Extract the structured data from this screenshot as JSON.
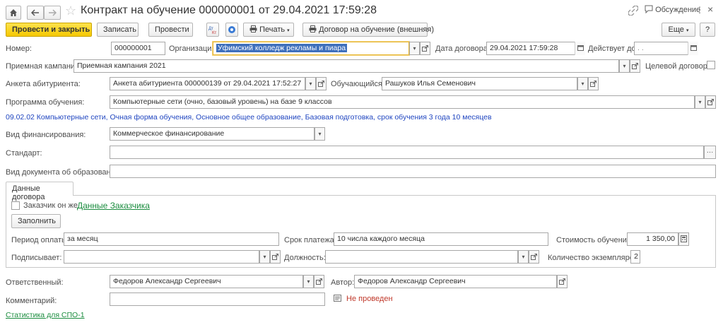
{
  "window": {
    "title": "Контракт на обучение 000000001 от 29.04.2021 17:59:28",
    "discussion": "Обсуждение",
    "more_menu": "⋮",
    "close": "×"
  },
  "toolbar": {
    "post_close": "Провести и закрыть",
    "save": "Записать",
    "post": "Провести",
    "print": "Печать",
    "contract_external": "Договор на обучение (внешняя)",
    "more": "Еще",
    "help": "?"
  },
  "form": {
    "number_label": "Номер:",
    "number": "000000001",
    "org_label": "Организация:",
    "org": "Уфимский колледж рекламы и пиара",
    "date_label": "Дата договора:",
    "date": "29.04.2021 17:59:28",
    "valid_label": "Действует до:",
    "valid": " .  .",
    "campaign_label": "Приемная кампания:",
    "campaign": "Приемная кампания 2021",
    "target_label": "Целевой договор:",
    "app_label": "Анкета абитуриента:",
    "app": "Анкета абитуриента 000000139 от 29.04.2021 17:52:27",
    "student_label": "Обучающийся:",
    "student": "Рашуков Илья Семенович",
    "program_label": "Программа обучения:",
    "program": "Компьютерные сети (очно, базовый уровень) на базе 9 классов",
    "program_info": "09.02.02   Компьютерные сети, Очная форма обучения, Основное общее образование, Базовая подготовка, срок обучения 3 года 10 месяцев",
    "finance_label": "Вид финансирования:",
    "finance": "Коммерческое финансирование",
    "standard_label": "Стандарт:",
    "standard": "",
    "doctype_label": "Вид документа об образовании:",
    "doctype": ""
  },
  "tab": {
    "label": "Данные договора",
    "customer_self": "Заказчик он же",
    "customer_data": "Данные Заказчика",
    "fill": "Заполнить",
    "period_label": "Период оплаты:",
    "period": "за месяц",
    "due_label": "Срок платежа:",
    "due": "10 числа каждого месяца",
    "cost_label": "Стоимость обучения:",
    "cost": "1 350,00",
    "signer_label": "Подписывает:",
    "signer": "",
    "position_label": "Должность:",
    "position": "",
    "copies_label": "Количество экземпляров:",
    "copies": "2"
  },
  "footer": {
    "responsible_label": "Ответственный:",
    "responsible": "Федоров Александр Сергеевич",
    "author_label": "Автор:",
    "author": "Федоров Александр Сергеевич",
    "comment_label": "Комментарий:",
    "comment": "",
    "status": "Не проведен",
    "stats_link": "Статистика для СПО-1"
  },
  "colors": {
    "primary_button": "#f5c800",
    "link_green": "#1a8c3e",
    "info_blue": "#2046c0",
    "status_red": "#c0392b"
  }
}
